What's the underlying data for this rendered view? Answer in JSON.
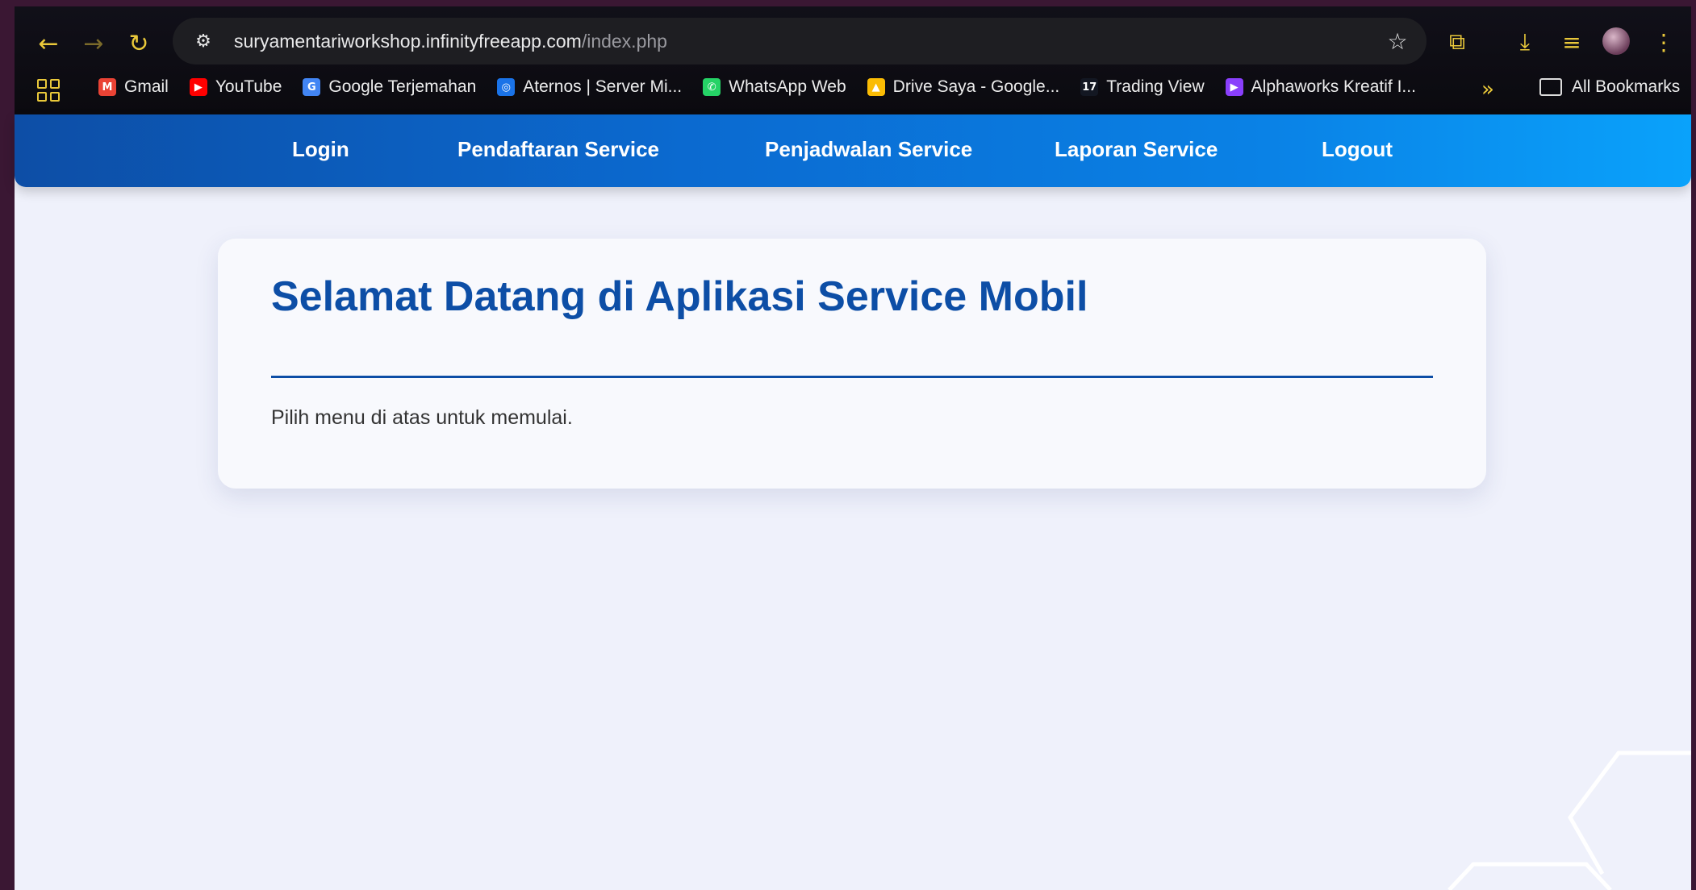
{
  "browser": {
    "url_host": "suryamentariworkshop.infinityfreeapp.com",
    "url_path": "/index.php",
    "bookmarks": [
      {
        "label": "Gmail",
        "icon": "gmail-icon",
        "color": "#ea4335"
      },
      {
        "label": "YouTube",
        "icon": "youtube-icon",
        "color": "#ff0000"
      },
      {
        "label": "Google Terjemahan",
        "icon": "translate-icon",
        "color": "#4285f4"
      },
      {
        "label": "Aternos | Server Mi...",
        "icon": "aternos-icon",
        "color": "#1a73e8"
      },
      {
        "label": "WhatsApp Web",
        "icon": "whatsapp-icon",
        "color": "#25d366"
      },
      {
        "label": "Drive Saya - Google...",
        "icon": "drive-icon",
        "color": "#fbbc04"
      },
      {
        "label": "Trading View",
        "icon": "tradingview-icon",
        "color": "#131722"
      },
      {
        "label": "Alphaworks Kreatif I...",
        "icon": "alphaworks-icon",
        "color": "#8a3ffc"
      }
    ],
    "all_bookmarks": "All Bookmarks"
  },
  "site_nav": {
    "items": [
      "Login",
      "Pendaftaran Service",
      "Penjadwalan Service",
      "Laporan Service",
      "Logout"
    ]
  },
  "main": {
    "title": "Selamat Datang di Aplikasi Service Mobil",
    "subtitle": "Pilih menu di atas untuk memulai."
  },
  "colors": {
    "nav_start": "#0d4ea6",
    "nav_end": "#0aa2fb",
    "heading": "#0d4ea6",
    "browser_accent": "#e9c83a"
  }
}
